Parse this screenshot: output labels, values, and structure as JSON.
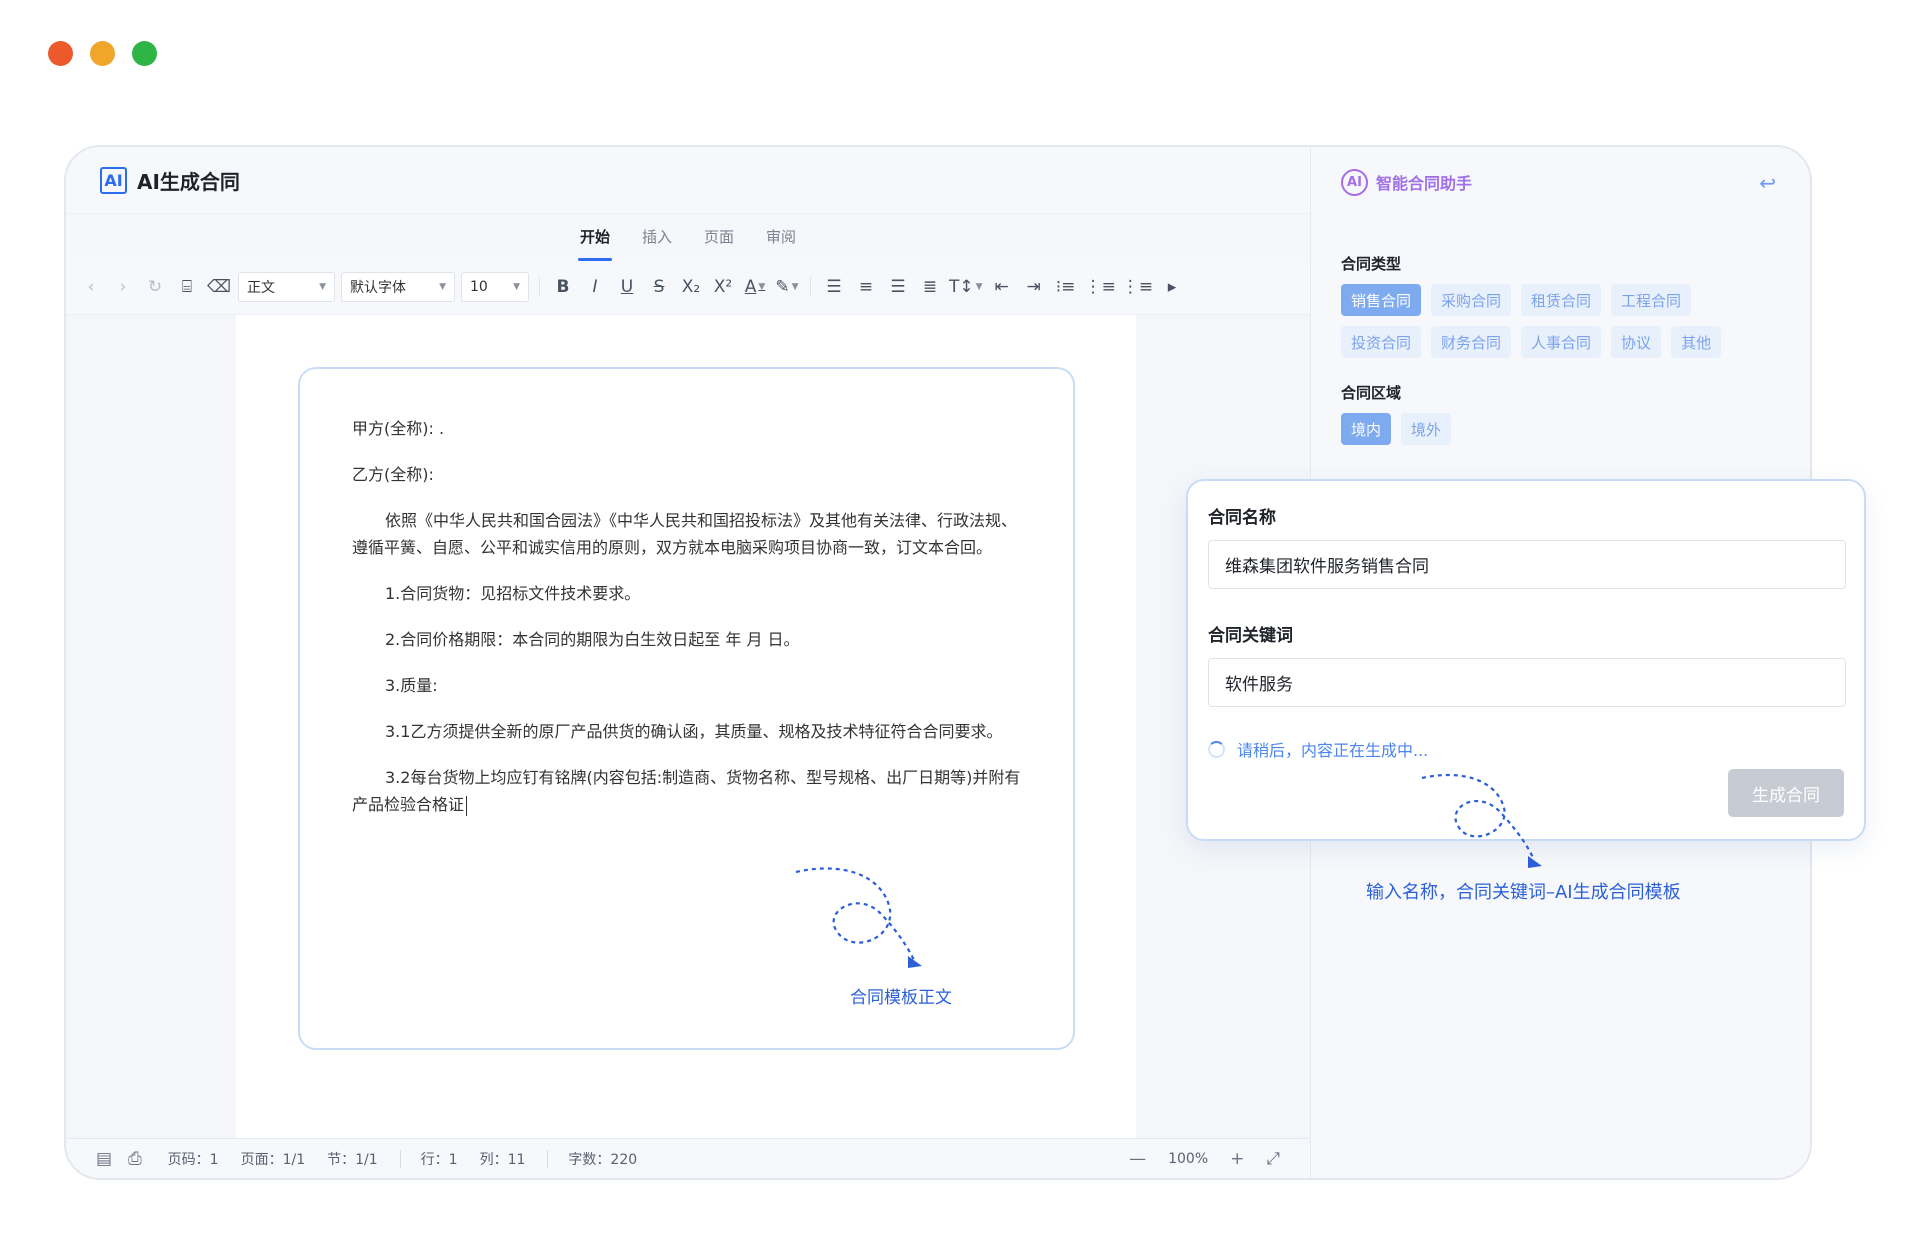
{
  "app": {
    "logo_text": "AI",
    "title": "AI生成合同"
  },
  "tabs": [
    {
      "label": "开始",
      "active": true
    },
    {
      "label": "插入",
      "active": false
    },
    {
      "label": "页面",
      "active": false
    },
    {
      "label": "审阅",
      "active": false
    }
  ],
  "toolbar": {
    "style_select": "正文",
    "font_select": "默认字体",
    "size_select": "10",
    "icons": [
      "undo-icon",
      "redo-icon",
      "repeat-icon",
      "format-painter-icon",
      "eraser-icon",
      "bold-icon",
      "italic-icon",
      "underline-icon",
      "strikethrough-icon",
      "subscript-icon",
      "superscript-icon",
      "font-color-icon",
      "highlight-icon",
      "align-left-icon",
      "align-center-icon",
      "align-right-icon",
      "justify-icon",
      "line-height-icon",
      "outdent-icon",
      "indent-icon",
      "bullet-list-icon",
      "numbered-list-icon",
      "multilevel-list-icon",
      "more-icon"
    ]
  },
  "document": {
    "paragraphs": [
      {
        "text": "甲方(全称): .",
        "indent": false
      },
      {
        "text": "乙方(全称):",
        "indent": false
      },
      {
        "text": "依照《中华人民共和国合园法》《中华人民共和国招投标法》及其他有关法律、行政法规、遵循平簧、自愿、公平和诚实信用的原则，双方就本电脑采购项目协商一致，订文本合回。",
        "indent": true
      },
      {
        "text": "1.合同货物：见招标文件技术要求。",
        "indent": true
      },
      {
        "text": "2.合同价格期限：本合同的期限为白生效日起至 年 月 日。",
        "indent": true
      },
      {
        "text": "3.质量:",
        "indent": true
      },
      {
        "text": "3.1乙方须提供全新的原厂产品供货的确认函，其质量、规格及技术特征符合合同要求。",
        "indent": true
      },
      {
        "text": "3.2每台货物上均应钉有铭牌(内容包括:制造商、货物名称、型号规格、出厂日期等)并附有产品检验合格证",
        "indent": true
      }
    ],
    "annotation": "合同模板正文"
  },
  "statusbar": {
    "page_code": "页码：1",
    "page": "页面：1/1",
    "section": "节：1/1",
    "line": "行：1",
    "column": "列：11",
    "word_count": "字数：220",
    "zoom": "100%"
  },
  "assistant": {
    "title": "智能合同助手",
    "logo_text": "AI",
    "contract_type_label": "合同类型",
    "contract_types": [
      {
        "label": "销售合同",
        "active": true
      },
      {
        "label": "采购合同",
        "active": false
      },
      {
        "label": "租赁合同",
        "active": false
      },
      {
        "label": "工程合同",
        "active": false
      },
      {
        "label": "投资合同",
        "active": false
      },
      {
        "label": "财务合同",
        "active": false
      },
      {
        "label": "人事合同",
        "active": false
      },
      {
        "label": "协议",
        "active": false
      },
      {
        "label": "其他",
        "active": false
      }
    ],
    "region_label": "合同区域",
    "regions": [
      {
        "label": "境内",
        "active": true
      },
      {
        "label": "境外",
        "active": false
      }
    ]
  },
  "form": {
    "name_label": "合同名称",
    "name_value": "维森集团软件服务销售合同",
    "keyword_label": "合同关键词",
    "keyword_value": "软件服务",
    "loading_text": "请稍后，内容正在生成中...",
    "generate_button": "生成合同",
    "annotation": "输入名称，合同关键词–AI生成合同模板"
  },
  "colors": {
    "accent": "#2b6cf0",
    "assistant_purple": "#a070ea",
    "annotation_blue": "#2b5fd9",
    "chip_bg": "#e8f0fc",
    "chip_active": "#7eaaf0"
  }
}
